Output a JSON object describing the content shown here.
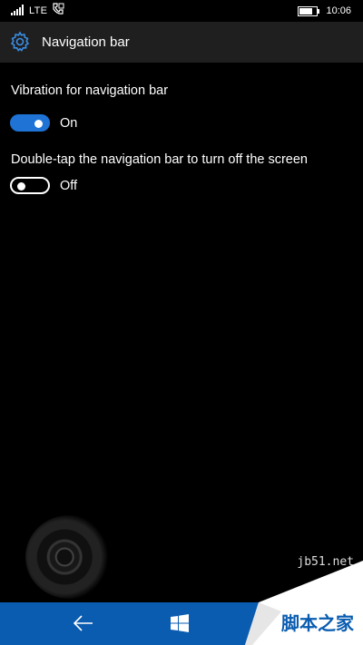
{
  "status_bar": {
    "network": "LTE",
    "time": "10:06",
    "battery_level": 0.85,
    "icons": [
      "signal-icon",
      "sim-phone-icon",
      "battery-icon"
    ]
  },
  "header": {
    "title": "Navigation bar",
    "icon": "gear-icon"
  },
  "settings": [
    {
      "label": "Vibration for navigation bar",
      "state": "On",
      "enabled": true
    },
    {
      "label": "Double-tap the navigation bar to turn off the screen",
      "state": "Off",
      "enabled": false
    }
  ],
  "nav_bar": {
    "icons": [
      "back-arrow-icon",
      "windows-logo-icon"
    ]
  },
  "watermark": {
    "site": "jb51.net",
    "text": "脚本之家"
  },
  "colors": {
    "accent": "#1e73d4",
    "nav_bar": "#0a5cb0",
    "header_bg": "#1f1f1f",
    "background": "#000000"
  }
}
